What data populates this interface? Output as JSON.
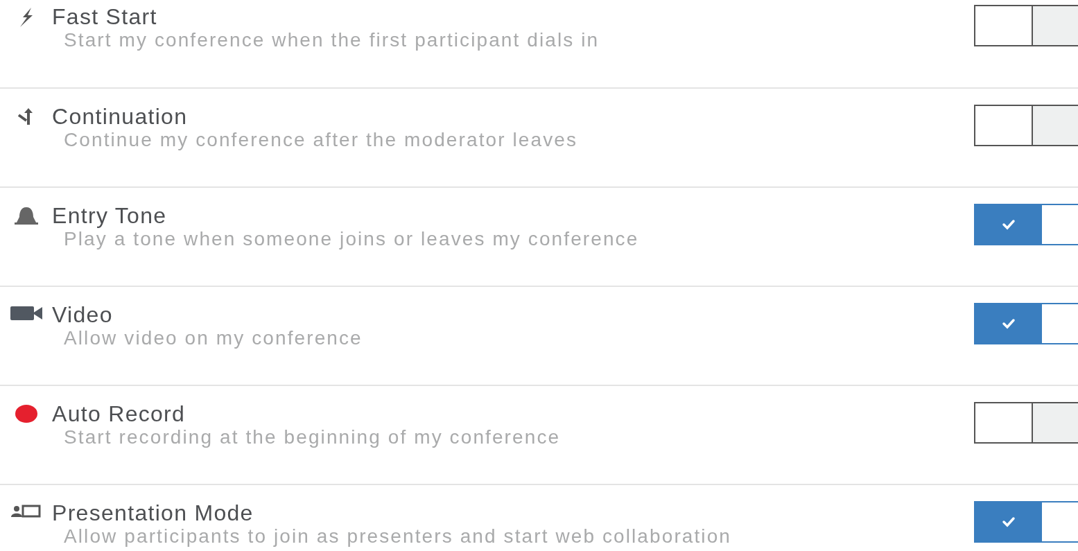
{
  "settings": [
    {
      "title": "Fast Start",
      "description": "Start my conference when the first participant dials in",
      "on": false
    },
    {
      "title": "Continuation",
      "description": "Continue my conference after the moderator leaves",
      "on": false
    },
    {
      "title": "Entry Tone",
      "description": "Play a tone when someone joins or leaves my conference",
      "on": true
    },
    {
      "title": "Video",
      "description": "Allow video on my conference",
      "on": true
    },
    {
      "title": "Auto Record",
      "description": "Start recording at the beginning of my conference",
      "on": false
    },
    {
      "title": "Presentation Mode",
      "description": "Allow participants to join as presenters and start web collaboration",
      "on": true
    }
  ]
}
